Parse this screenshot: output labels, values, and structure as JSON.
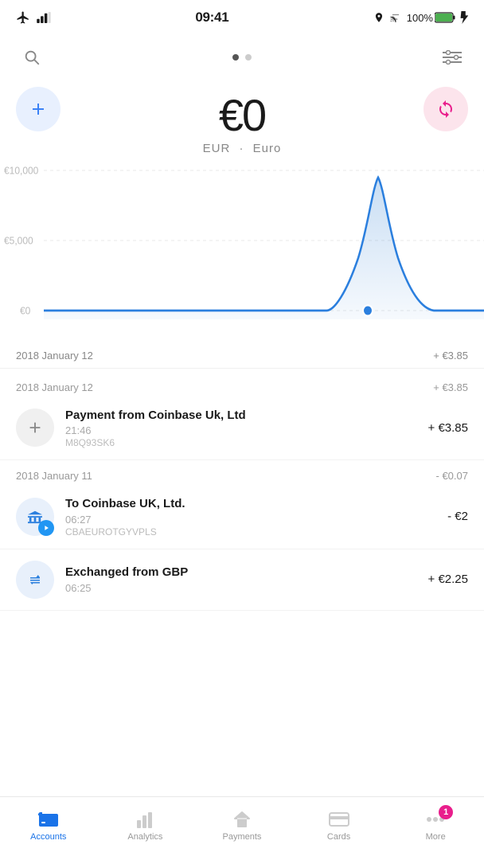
{
  "statusBar": {
    "time": "09:41",
    "battery": "100%"
  },
  "topBar": {
    "pageIndicator": [
      true,
      false
    ]
  },
  "balance": {
    "currencySymbol": "€",
    "amount": "0",
    "currencyCode": "EUR",
    "currencyName": "Euro"
  },
  "chart": {
    "labels": [
      "€10,000",
      "€5,000",
      "€0"
    ],
    "dateLabel": "2018 January 12",
    "valueLabel": "+ €3.85"
  },
  "transactions": [
    {
      "dateHeader": "2018 January 12",
      "dateValue": "+ €3.85",
      "items": [
        {
          "iconType": "plus",
          "title": "Payment from Coinbase Uk, Ltd",
          "time": "21:46",
          "ref": "M8Q93SK6",
          "amount": "+ €3.85",
          "positive": true
        }
      ]
    },
    {
      "dateHeader": "2018 January 11",
      "dateValue": "- €0.07",
      "items": [
        {
          "iconType": "bank-transfer",
          "title": "To Coinbase UK, Ltd.",
          "time": "06:27",
          "ref": "CBAEUROTGYVPLS",
          "amount": "- €2",
          "positive": false
        },
        {
          "iconType": "exchange",
          "title": "Exchanged from GBP",
          "time": "06:25",
          "ref": "",
          "amount": "+ €2.25",
          "positive": true
        }
      ]
    }
  ],
  "nav": {
    "items": [
      {
        "id": "accounts",
        "label": "Accounts",
        "active": true
      },
      {
        "id": "analytics",
        "label": "Analytics",
        "active": false
      },
      {
        "id": "payments",
        "label": "Payments",
        "active": false
      },
      {
        "id": "cards",
        "label": "Cards",
        "active": false
      },
      {
        "id": "more",
        "label": "More",
        "active": false,
        "badge": "1"
      }
    ]
  },
  "addButton": {
    "label": "+"
  },
  "syncButton": {
    "label": "↻"
  }
}
